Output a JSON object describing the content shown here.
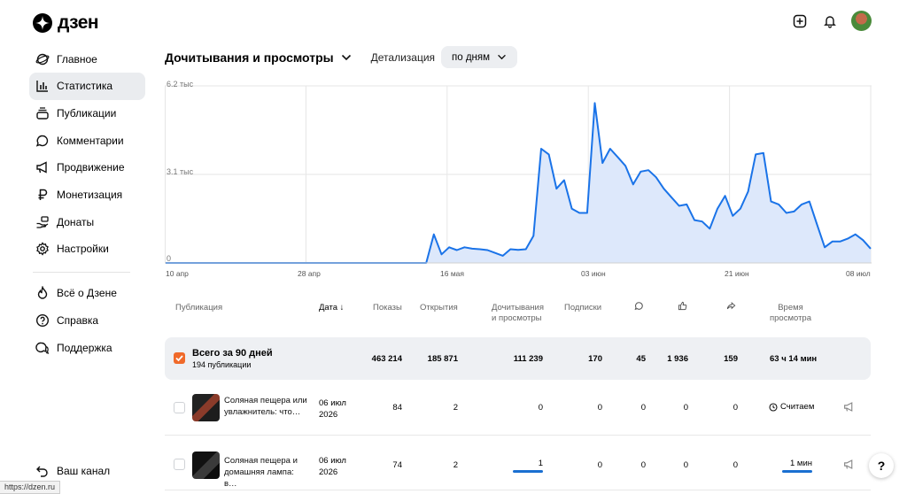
{
  "app": {
    "logo_text": "дзен"
  },
  "sidebar": {
    "items": [
      {
        "label": "Главное",
        "icon": "planet-icon"
      },
      {
        "label": "Статистика",
        "icon": "bar-chart-icon",
        "active": true
      },
      {
        "label": "Публикации",
        "icon": "stack-icon"
      },
      {
        "label": "Комментарии",
        "icon": "comment-icon"
      },
      {
        "label": "Продвижение",
        "icon": "megaphone-icon"
      },
      {
        "label": "Монетизация",
        "icon": "ruble-icon"
      },
      {
        "label": "Донаты",
        "icon": "donate-icon"
      },
      {
        "label": "Настройки",
        "icon": "gear-icon"
      }
    ],
    "secondary": [
      {
        "label": "Всё о Дзене",
        "icon": "flame-icon"
      },
      {
        "label": "Справка",
        "icon": "help-circle-icon"
      },
      {
        "label": "Поддержка",
        "icon": "chat-icon"
      }
    ],
    "bottom": {
      "label": "Ваш канал",
      "icon": "back-arrow-icon"
    }
  },
  "header": {
    "title": "Дочитывания и просмотры",
    "detail_label": "Детализация",
    "detail_value": "по дням"
  },
  "chart_data": {
    "type": "area",
    "y_ticks": [
      "6.2 тыс",
      "3.1 тыс",
      "0"
    ],
    "ylim": [
      0,
      6200
    ],
    "x_ticks": [
      "10 апр",
      "28 апр",
      "16 мая",
      "03 июн",
      "21 июн",
      "08 июл"
    ],
    "color": "#1a73e8",
    "fill": "#dde8fb",
    "grid": true,
    "values": [
      0,
      0,
      0,
      0,
      0,
      0,
      0,
      0,
      0,
      0,
      0,
      0,
      0,
      0,
      0,
      0,
      0,
      0,
      0,
      0,
      0,
      0,
      0,
      0,
      0,
      0,
      0,
      0,
      0,
      0,
      0,
      0,
      0,
      0,
      0,
      1000,
      300,
      550,
      450,
      550,
      500,
      480,
      450,
      350,
      250,
      480,
      460,
      480,
      950,
      4000,
      3800,
      2600,
      2900,
      1900,
      1750,
      1750,
      5600,
      3500,
      4000,
      3700,
      3400,
      2750,
      3200,
      3250,
      3000,
      2600,
      2300,
      2000,
      2050,
      1500,
      1450,
      1200,
      1900,
      2350,
      1650,
      1900,
      2500,
      3800,
      3850,
      2150,
      2050,
      1750,
      1800,
      2050,
      2150,
      1350,
      550,
      750,
      750,
      850,
      1000,
      800,
      500
    ]
  },
  "table": {
    "headers": {
      "publication": "Публикация",
      "date": "Дата ↓",
      "shows": "Показы",
      "opens": "Открытия",
      "reads": "Дочитывания\nи просмотры",
      "subs": "Подписки",
      "time": "Время\nпросмотра"
    },
    "total": {
      "title": "Всего за 90 дней",
      "subtitle": "194 публикации",
      "shows": "463 214",
      "opens": "185 871",
      "reads": "111 239",
      "subs": "170",
      "comments": "45",
      "likes": "1 936",
      "shares": "159",
      "time": "63 ч 14 мин"
    },
    "rows": [
      {
        "title": "Соляная пещера или увлажнитель: что…",
        "date": "06 июл\n2026",
        "shows": "84",
        "opens": "2",
        "reads": "0",
        "subs": "0",
        "comments": "0",
        "likes": "0",
        "shares": "0",
        "time": "Считаем"
      },
      {
        "title": "Соляная пещера и домашняя лампа: в…",
        "date": "06 июл\n2026",
        "shows": "74",
        "opens": "2",
        "reads": "1",
        "subs": "0",
        "comments": "0",
        "likes": "0",
        "shares": "0",
        "time": "1 мин"
      }
    ]
  },
  "help_button": "?",
  "status_url": "https://dzen.ru"
}
